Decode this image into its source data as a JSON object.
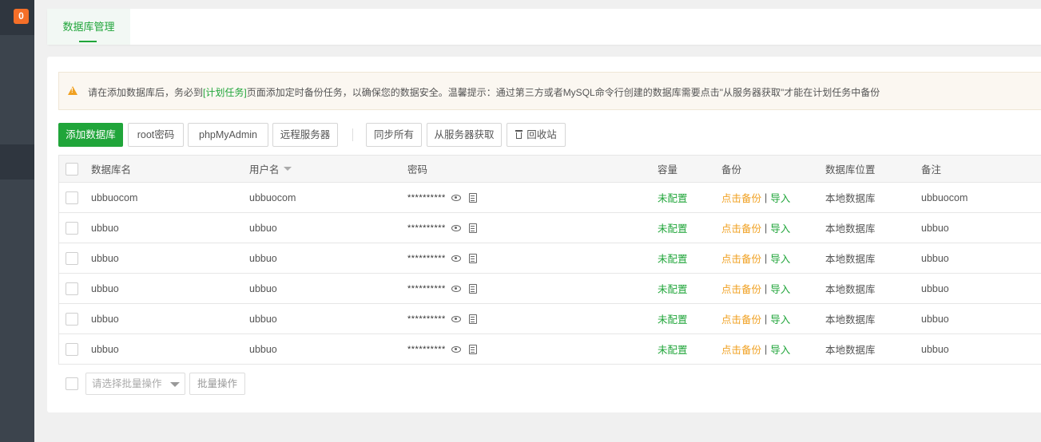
{
  "sidebar": {
    "badge": "0"
  },
  "tabs": [
    {
      "label": "数据库管理"
    }
  ],
  "notice": {
    "before": "请在添加数据库后，务必到",
    "link": "[计划任务]",
    "after": "页面添加定时备份任务，以确保您的数据安全。温馨提示：通过第三方或者MySQL命令行创建的数据库需要点击\"从服务器获取\"才能在计划任务中备份"
  },
  "toolbar": {
    "add": "添加数据库",
    "root_pwd": "root密码",
    "phpmyadmin": "phpMyAdmin",
    "remote": "远程服务器",
    "sync_all": "同步所有",
    "fetch": "从服务器获取",
    "recycle": "回收站"
  },
  "table": {
    "headers": {
      "name": "数据库名",
      "user": "用户名",
      "password": "密码",
      "capacity": "容量",
      "backup": "备份",
      "location": "数据库位置",
      "note": "备注"
    },
    "rows": [
      {
        "name": "ubbuocom",
        "user": "ubbuocom",
        "password": "**********",
        "capacity": "未配置",
        "backup": "点击备份",
        "import": "导入",
        "location": "本地数据库",
        "note": "ubbuocom"
      },
      {
        "name": "ubbuo",
        "user": "ubbuo",
        "password": "**********",
        "capacity": "未配置",
        "backup": "点击备份",
        "import": "导入",
        "location": "本地数据库",
        "note": "ubbuo"
      },
      {
        "name": "ubbuo",
        "user": "ubbuo",
        "password": "**********",
        "capacity": "未配置",
        "backup": "点击备份",
        "import": "导入",
        "location": "本地数据库",
        "note": "ubbuo"
      },
      {
        "name": "ubbuo",
        "user": "ubbuo",
        "password": "**********",
        "capacity": "未配置",
        "backup": "点击备份",
        "import": "导入",
        "location": "本地数据库",
        "note": "ubbuo"
      },
      {
        "name": "ubbuo",
        "user": "ubbuo",
        "password": "**********",
        "capacity": "未配置",
        "backup": "点击备份",
        "import": "导入",
        "location": "本地数据库",
        "note": "ubbuo"
      },
      {
        "name": "ubbuo",
        "user": "ubbuo",
        "password": "**********",
        "capacity": "未配置",
        "backup": "点击备份",
        "import": "导入",
        "location": "本地数据库",
        "note": "ubbuo"
      }
    ]
  },
  "batch": {
    "placeholder": "请选择批量操作",
    "button": "批量操作"
  },
  "colors": {
    "accent": "#20a53a",
    "warning": "#f0a020",
    "badge": "#f56f28",
    "sidebar": "#3c444d"
  }
}
